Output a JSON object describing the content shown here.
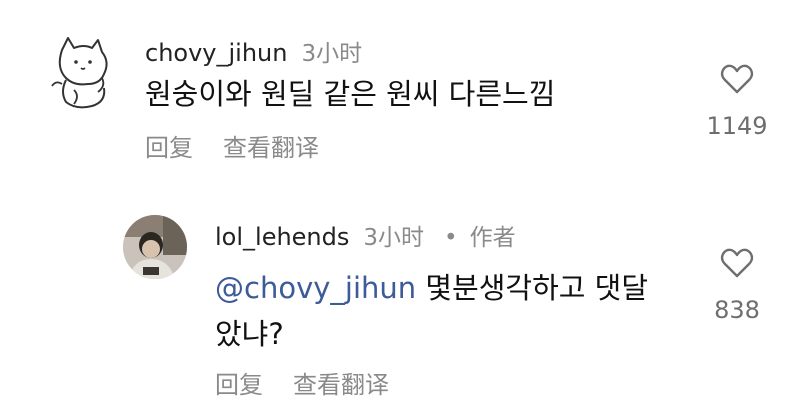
{
  "comments": [
    {
      "username": "chovy_jihun",
      "time": "3小时",
      "text": "원숭이와 원딜 같은 원씨 다른느낌",
      "reply_label": "回复",
      "translate_label": "查看翻译",
      "likes": "1149",
      "avatar_icon": "cat-doodle-icon"
    },
    {
      "username": "lol_lehends",
      "time": "3小时",
      "author_tag": "作者",
      "mention": "@chovy_jihun",
      "text_line1": "몇분생각하고 댓달",
      "text_line2": "았냐?",
      "reply_label": "回复",
      "translate_label": "查看翻译",
      "likes": "838",
      "avatar_icon": "profile-photo"
    }
  ],
  "colors": {
    "mention": "#3d5a99",
    "secondary_text": "#8a8a8a",
    "primary_text": "#111111"
  }
}
